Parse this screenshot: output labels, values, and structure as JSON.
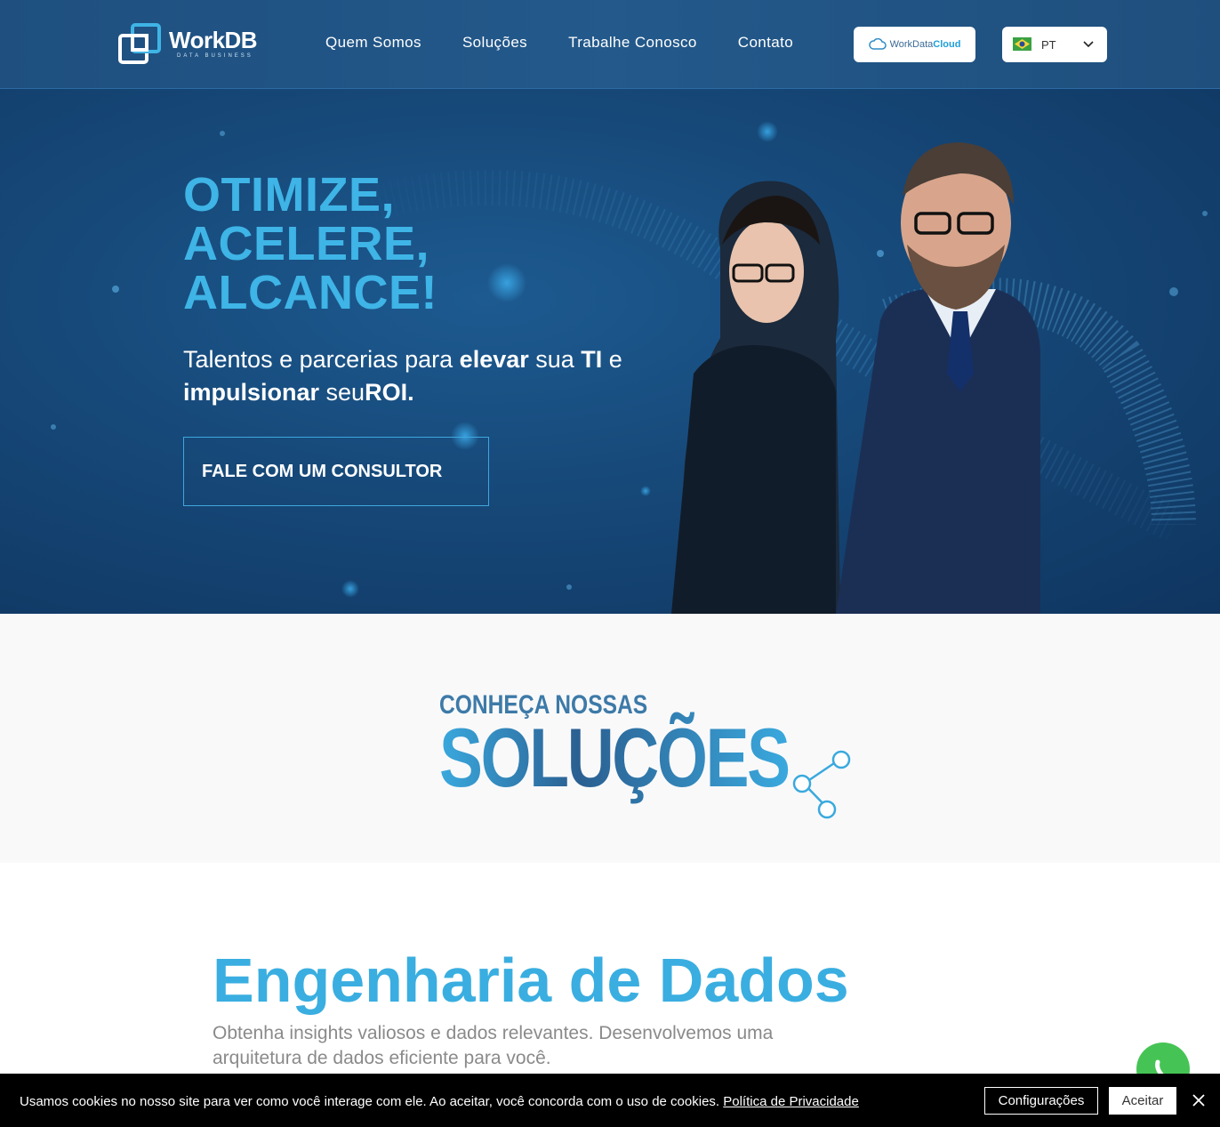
{
  "nav": {
    "logo_name": "WorkDB",
    "logo_sub": "DATA BUSINESS",
    "menu": [
      "Quem Somos",
      "Soluções",
      "Trabalhe Conosco",
      "Contato"
    ],
    "cloud_button": {
      "text_main": "WorkData",
      "text_accent": "Cloud"
    },
    "language": {
      "selected": "PT",
      "flag_icon": "brazil-flag-icon"
    }
  },
  "hero": {
    "title_lines": [
      "OTIMIZE,",
      "ACELERE,",
      "ALCANCE!"
    ],
    "subtitle": {
      "p1": "Talentos e parcerias para ",
      "b1": "elevar",
      "p2": " sua ",
      "b2": "TI",
      "p3": " e ",
      "b3": "impulsionar",
      "p4": " seu",
      "b4": "ROI."
    },
    "cta": "FALE COM UM CONSULTOR"
  },
  "solutions": {
    "kicker": "CONHEÇA NOSSAS",
    "title": "SOLUÇÕES"
  },
  "engineering": {
    "title": "Engenharia de Dados",
    "description": "Obtenha insights valiosos e dados relevantes. Desenvolvemos uma arquitetura de dados eficiente para você."
  },
  "cookie": {
    "text": "Usamos cookies no nosso site para ver como você interage com ele. Ao aceitar, você concorda com o uso de cookies. ",
    "link": "Política de Privacidade",
    "settings_button": "Configurações",
    "accept_button": "Aceitar"
  },
  "colors": {
    "brand_blue": "#1e4f7f",
    "accent_cyan": "#3fb4e6",
    "whatsapp_green": "#45c455"
  }
}
